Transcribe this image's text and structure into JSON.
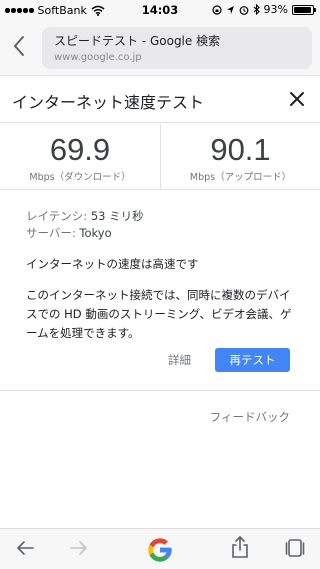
{
  "status_bar": {
    "carrier": "SoftBank",
    "time": "14:03",
    "battery": "93%",
    "battery_level": 0.93
  },
  "browser": {
    "page_title": "スピードテスト - Google 検索",
    "domain": "www.google.co.jp"
  },
  "panel": {
    "title": "インターネット速度テスト",
    "download": {
      "value": "69.9",
      "label": "Mbps（ダウンロード）"
    },
    "upload": {
      "value": "90.1",
      "label": "Mbps（アップロード）"
    },
    "latency_label": "レイテンシ:",
    "latency_value": "53 ミリ秒",
    "server_label": "サーバー:",
    "server_value": "Tokyo",
    "summary": "インターネットの速度は高速です",
    "description": "このインターネット接続では、同時に複数のデバイスでの HD 動画のストリーミング、ビデオ会議、ゲームを処理できます。",
    "details_label": "詳細",
    "retest_label": "再テスト",
    "feedback_label": "フィードバック"
  },
  "colors": {
    "accent": "#4285f4",
    "google_blue": "#4285f4",
    "google_red": "#ea4335",
    "google_yellow": "#fbbc05",
    "google_green": "#34a853"
  },
  "toolbar": {
    "icons": [
      "back-arrow-icon",
      "forward-arrow-icon",
      "google-logo-icon",
      "share-icon",
      "tabs-icon"
    ]
  }
}
